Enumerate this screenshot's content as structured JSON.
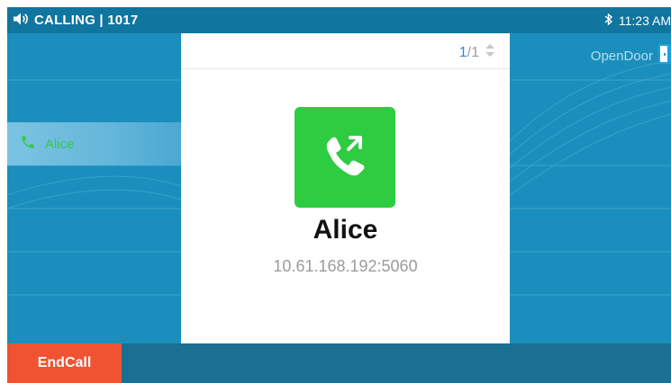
{
  "status_bar": {
    "title": "CALLING | 1017",
    "icon": "speaker-icon",
    "bluetooth_icon": "bluetooth-icon",
    "time": "11:23 AM"
  },
  "accounts": [
    {
      "label": "Alice",
      "icon": "phone-icon",
      "color": "#37c94a"
    }
  ],
  "opendoor": {
    "label": "OpenDoor",
    "icon": "door-icon"
  },
  "call": {
    "page_current": "1",
    "page_total": "/1",
    "name": "Alice",
    "address": "10.61.168.192:5060",
    "badge_icon": "outgoing-call-icon",
    "badge_color": "#2ecc40"
  },
  "softkeys": {
    "end_call": "EndCall",
    "end_call_color": "#f05332"
  }
}
